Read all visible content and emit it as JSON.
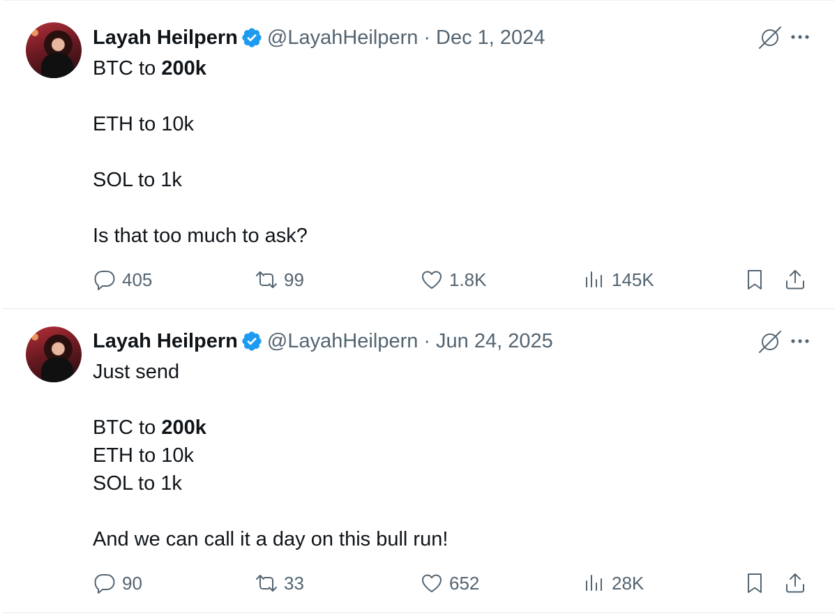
{
  "colors": {
    "verified": "#1d9bf0",
    "secondary_text": "#536471",
    "primary_text": "#0f1419",
    "divider": "#e3e8ec"
  },
  "tweets": [
    {
      "author": {
        "name": "Layah Heilpern",
        "handle": "@LayahHeilpern",
        "verified": true
      },
      "separator": "·",
      "date": "Dec 1, 2024",
      "lines": {
        "l1_prefix": "BTC to ",
        "l1_bold": "200k",
        "l2": "ETH to 10k",
        "l3": "SOL to 1k",
        "l4": "Is that too much to ask?"
      },
      "stats": {
        "replies": "405",
        "reposts": "99",
        "likes": "1.8K",
        "views": "145K"
      }
    },
    {
      "author": {
        "name": "Layah Heilpern",
        "handle": "@LayahHeilpern",
        "verified": true
      },
      "separator": "·",
      "date": "Jun 24, 2025",
      "lines": {
        "l1": "Just send",
        "l2_prefix": "BTC to ",
        "l2_bold": "200k",
        "l3": "ETH to 10k",
        "l4": "SOL to 1k",
        "l5": "And we can call it a day on this bull run!"
      },
      "stats": {
        "replies": "90",
        "reposts": "33",
        "likes": "652",
        "views": "28K"
      }
    }
  ],
  "icons": [
    "verified-badge-icon",
    "grok-icon",
    "more-icon",
    "reply-icon",
    "repost-icon",
    "like-icon",
    "views-icon",
    "bookmark-icon",
    "share-icon"
  ]
}
